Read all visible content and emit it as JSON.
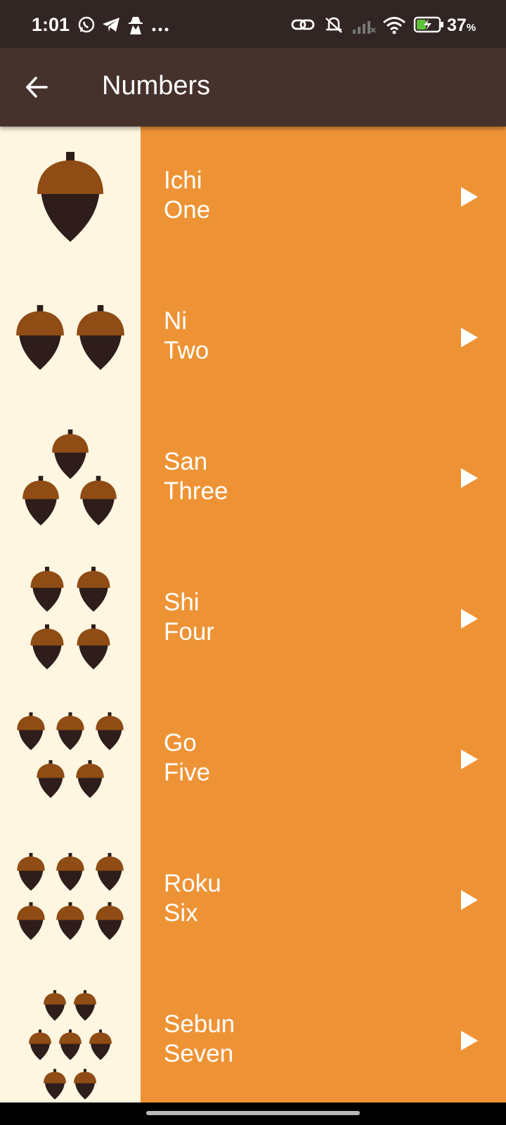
{
  "status_bar": {
    "time": "1:01",
    "left_icons": [
      "whatsapp-icon",
      "telegram-icon",
      "incognito-icon",
      "more-dots-icon"
    ],
    "right_icons": [
      "link-icon",
      "bell-muted-icon",
      "signal-icon",
      "wifi-icon",
      "battery-charging-icon"
    ],
    "battery_percent": "37",
    "battery_unit": "%"
  },
  "app_bar": {
    "title": "Numbers",
    "back_icon": "arrow-left-icon"
  },
  "colors": {
    "status_bar_bg": "#322624",
    "app_bar_bg": "#46322d",
    "row_bg": "#ee9335",
    "thumb_bg": "#fef6e1",
    "acorn_cap": "#8f4c14",
    "acorn_body": "#2e1d1b",
    "text": "#ffffff"
  },
  "rows": [
    {
      "japanese": "Ichi",
      "english": "One",
      "acorn_count": 1,
      "icon": "play-icon"
    },
    {
      "japanese": "Ni",
      "english": "Two",
      "acorn_count": 2,
      "icon": "play-icon"
    },
    {
      "japanese": "San",
      "english": "Three",
      "acorn_count": 3,
      "icon": "play-icon"
    },
    {
      "japanese": "Shi",
      "english": "Four",
      "acorn_count": 4,
      "icon": "play-icon"
    },
    {
      "japanese": "Go",
      "english": "Five",
      "acorn_count": 5,
      "icon": "play-icon"
    },
    {
      "japanese": "Roku",
      "english": "Six",
      "acorn_count": 6,
      "icon": "play-icon"
    },
    {
      "japanese": "Sebun",
      "english": "Seven",
      "acorn_count": 7,
      "icon": "play-icon"
    }
  ]
}
